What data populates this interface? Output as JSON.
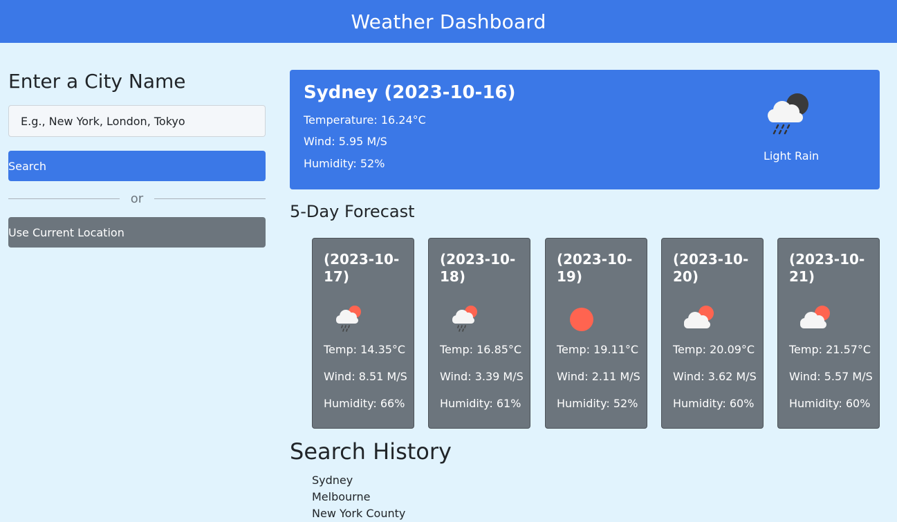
{
  "header": {
    "title": "Weather Dashboard"
  },
  "sidebar": {
    "heading": "Enter a City Name",
    "input_placeholder": "E.g., New York, London, Tokyo",
    "input_value": "",
    "search_label": "Search",
    "or_label": "or",
    "location_label": "Use Current Location"
  },
  "current": {
    "title": "Sydney (2023-10-16)",
    "temperature": "Temperature: 16.24°C",
    "wind": "Wind: 5.95 M/S",
    "humidity": "Humidity: 52%",
    "description": "Light Rain",
    "icon": "rain-cloud-night-icon"
  },
  "forecast": {
    "title": "5-Day Forecast",
    "days": [
      {
        "date": "(2023-10-17)",
        "temp": "Temp: 14.35°C",
        "wind": "Wind: 8.51 M/S",
        "humidity": "Humidity: 66%",
        "icon": "rain-cloud-sun-icon"
      },
      {
        "date": "(2023-10-18)",
        "temp": "Temp: 16.85°C",
        "wind": "Wind: 3.39 M/S",
        "humidity": "Humidity: 61%",
        "icon": "rain-cloud-sun-icon"
      },
      {
        "date": "(2023-10-19)",
        "temp": "Temp: 19.11°C",
        "wind": "Wind: 2.11 M/S",
        "humidity": "Humidity: 52%",
        "icon": "sun-icon"
      },
      {
        "date": "(2023-10-20)",
        "temp": "Temp: 20.09°C",
        "wind": "Wind: 3.62 M/S",
        "humidity": "Humidity: 60%",
        "icon": "cloud-sun-icon"
      },
      {
        "date": "(2023-10-21)",
        "temp": "Temp: 21.57°C",
        "wind": "Wind: 5.57 M/S",
        "humidity": "Humidity: 60%",
        "icon": "cloud-sun-icon"
      }
    ]
  },
  "history": {
    "title": "Search History",
    "items": [
      "Sydney",
      "Melbourne",
      "New York County"
    ]
  },
  "colors": {
    "primary": "#3b78e7",
    "secondary": "#6c757d",
    "background": "#e1f3fd",
    "sun": "#ff6450"
  }
}
